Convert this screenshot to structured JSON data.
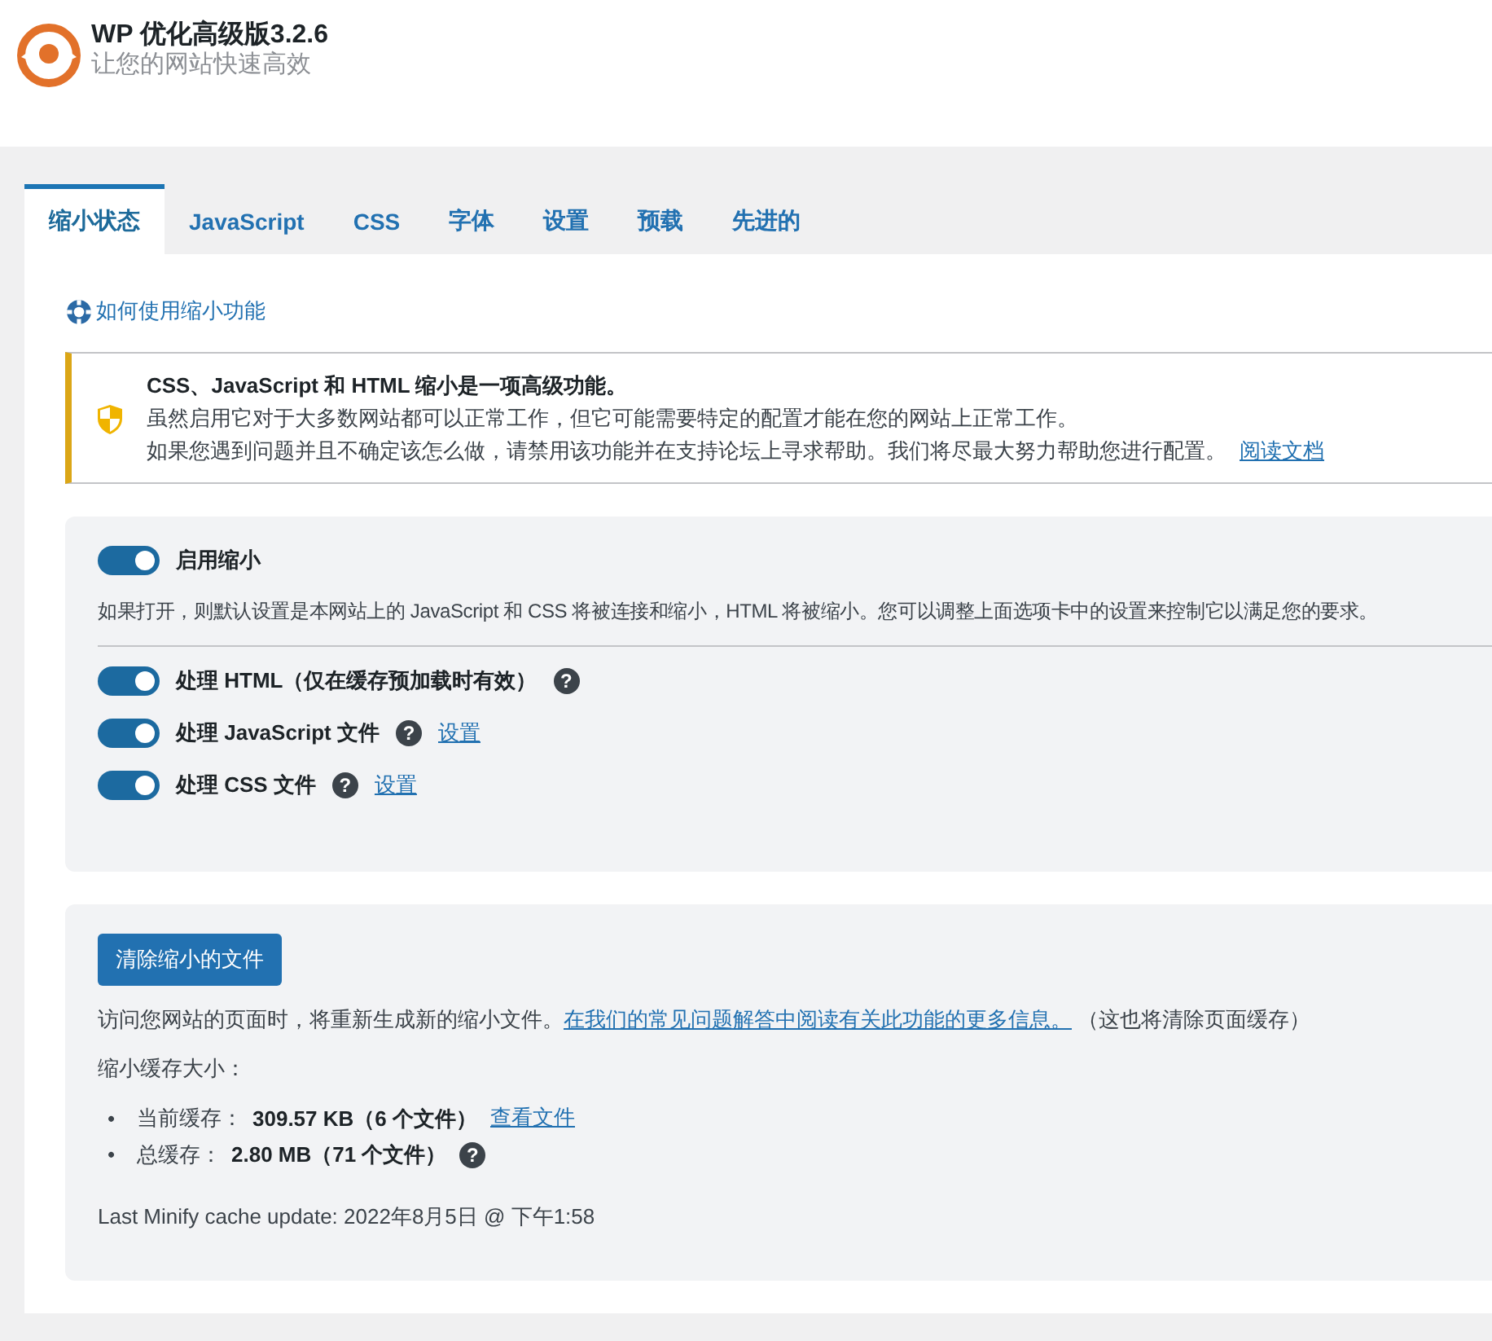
{
  "header": {
    "title": "WP 优化高级版3.2.6",
    "subtitle": "让您的网站快速高效"
  },
  "tabs": [
    {
      "label": "缩小状态",
      "selected": true
    },
    {
      "label": "JavaScript",
      "selected": false
    },
    {
      "label": "CSS",
      "selected": false
    },
    {
      "label": "字体",
      "selected": false
    },
    {
      "label": "设置",
      "selected": false
    },
    {
      "label": "预载",
      "selected": false
    },
    {
      "label": "先进的",
      "selected": false
    }
  ],
  "help_link": "如何使用缩小功能",
  "notice": {
    "title": "CSS、JavaScript 和 HTML 缩小是一项高级功能。",
    "lines": [
      "虽然启用它对于大多数网站都可以正常工作，但它可能需要特定的配置才能在您的网站上正常工作。",
      "如果您遇到问题并且不确定该怎么做，请禁用该功能并在支持论坛上寻求帮助。我们将尽最大努力帮助您进行配置。"
    ],
    "link": "阅读文档"
  },
  "settings": {
    "main_toggle": {
      "label": "启用缩小",
      "on": true
    },
    "description": "如果打开，则默认设置是本网站上的 JavaScript 和 CSS 将被连接和缩小，HTML 将被缩小。您可以调整上面选项卡中的设置来控制它以满足您的要求。",
    "options": [
      {
        "label": "处理 HTML（仅在缓存预加载时有效）",
        "on": true,
        "help": "?"
      },
      {
        "label": "处理 JavaScript 文件",
        "on": true,
        "help": "?",
        "link": "设置"
      },
      {
        "label": "处理 CSS 文件",
        "on": true,
        "help": "?",
        "link": "设置"
      }
    ]
  },
  "cache": {
    "button": "清除缩小的文件",
    "description": "访问您网站的页面时，将重新生成新的缩小文件。",
    "description_link": "在我们的常见问题解答中阅读有关此功能的更多信息。",
    "description_note": "（这也将清除页面缓存）",
    "size_label": "缩小缓存大小：",
    "items": [
      {
        "marker": "•",
        "label": "当前缓存：",
        "value": "309.57 KB（6 个文件）",
        "link": "查看文件"
      },
      {
        "marker": "•",
        "label": "总缓存：",
        "value": "2.80 MB（71 个文件）",
        "help": "?"
      }
    ],
    "last_update": "Last Minify cache update: 2022年8月5日 @ 下午1:58"
  }
}
